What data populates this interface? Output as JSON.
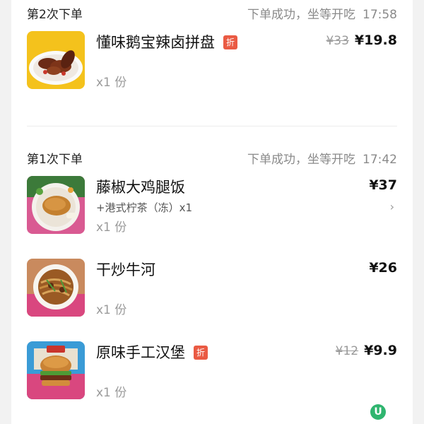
{
  "orders": [
    {
      "round_label": "第2次下单",
      "status": "下单成功，坐等开吃",
      "time": "17:58",
      "items": [
        {
          "name": "懂味鹅宝辣卤拼盘",
          "discount_badge": "折",
          "original_price": "¥33",
          "price": "¥19.8",
          "qty": "x1 份"
        }
      ]
    },
    {
      "round_label": "第1次下单",
      "status": "下单成功，坐等开吃",
      "time": "17:42",
      "items": [
        {
          "name": "藤椒大鸡腿饭",
          "addon": "+港式柠茶（冻）x1",
          "price": "¥37",
          "qty": "x1 份"
        },
        {
          "name": "干炒牛河",
          "price": "¥26",
          "qty": "x1 份"
        },
        {
          "name": "原味手工汉堡",
          "discount_badge": "折",
          "original_price": "¥12",
          "price": "¥9.9",
          "qty": "x1 份"
        }
      ]
    }
  ],
  "icons": {
    "chevron": "chevron-right-icon",
    "floating": "u-logo-icon"
  },
  "fab_label": "U",
  "colors": {
    "discount_badge": "#ea5a43",
    "muted_text": "#9a9a9a",
    "logo_green": "#2fb56f"
  }
}
